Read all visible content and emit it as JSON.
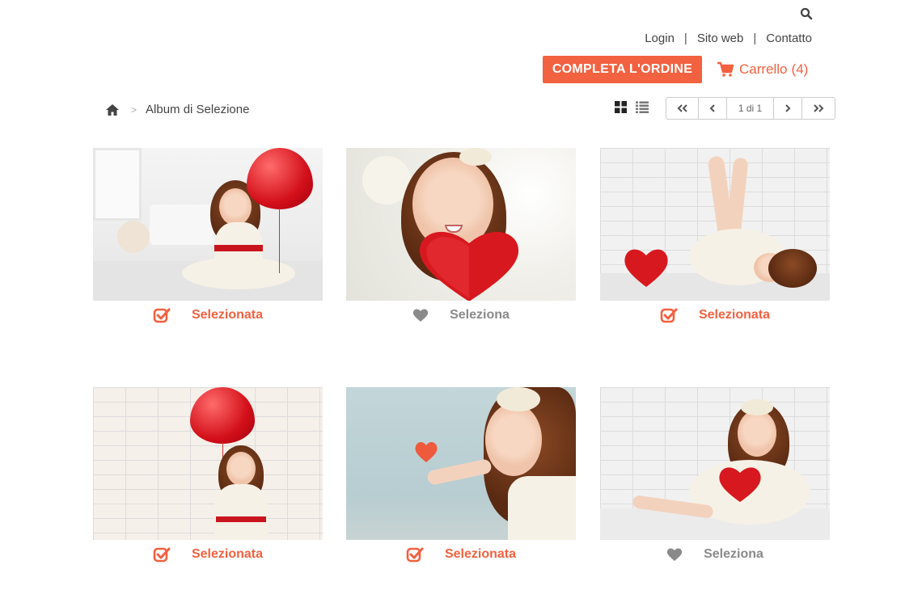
{
  "nav": {
    "links": [
      "Login",
      "Sito web",
      "Contatto"
    ],
    "separator": "|"
  },
  "order_button": "COMPLETA L'ORDINE",
  "cart": {
    "label": "Carrello",
    "count": "(4)"
  },
  "breadcrumb": {
    "separator": ">",
    "current": "Album di Selezione"
  },
  "pager": {
    "info": "1 di 1"
  },
  "colors": {
    "accent": "#f26140",
    "muted": "#8a8a8a"
  },
  "icons": [
    "search-icon",
    "home-icon",
    "grid-view-icon",
    "list-view-icon",
    "first-page-icon",
    "prev-page-icon",
    "next-page-icon",
    "last-page-icon",
    "cart-icon",
    "check-icon",
    "heart-icon"
  ],
  "photos": [
    {
      "state": "Selezionata",
      "selected": true
    },
    {
      "state": "Seleziona",
      "selected": false
    },
    {
      "state": "Selezionata",
      "selected": true
    },
    {
      "state": "Selezionata",
      "selected": true
    },
    {
      "state": "Selezionata",
      "selected": true
    },
    {
      "state": "Seleziona",
      "selected": false
    }
  ]
}
